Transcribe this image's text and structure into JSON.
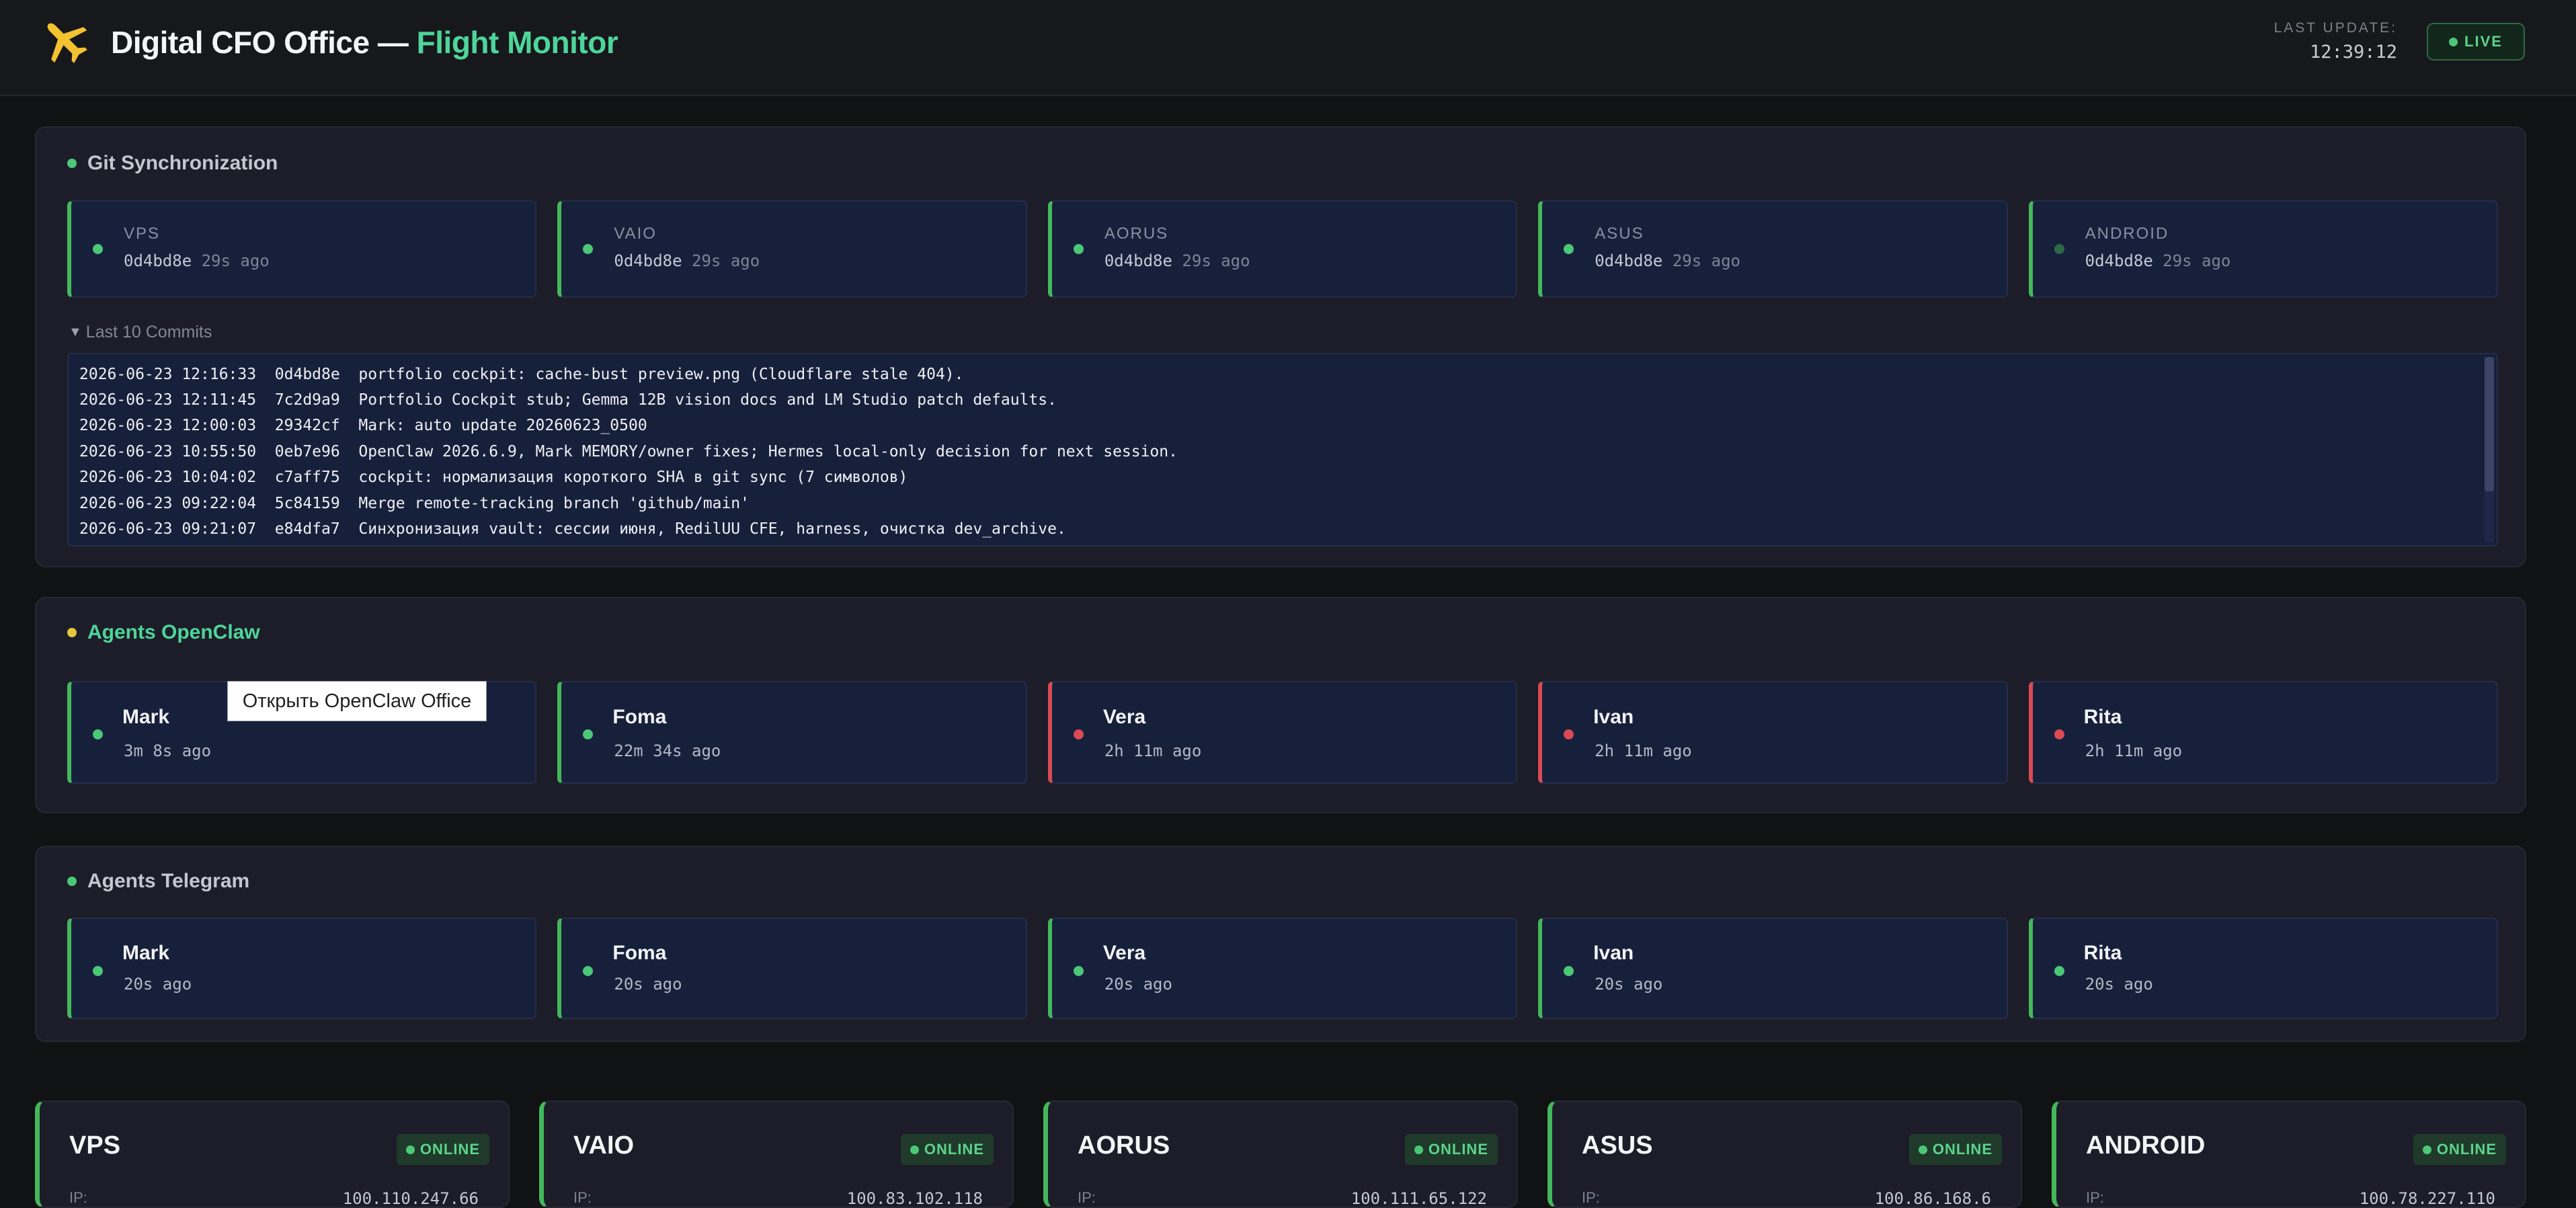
{
  "header": {
    "title_main": "Digital CFO Office — ",
    "title_accent": "Flight Monitor",
    "last_update_label": "LAST UPDATE:",
    "last_update_time": "12:39:12",
    "live_label": "LIVE",
    "accent_color": "#4ed59a"
  },
  "git": {
    "title": "Git Synchronization",
    "hosts": [
      {
        "name": "VPS",
        "hash": "0d4bd8e",
        "ago": "29s ago"
      },
      {
        "name": "VAIO",
        "hash": "0d4bd8e",
        "ago": "29s ago"
      },
      {
        "name": "AORUS",
        "hash": "0d4bd8e",
        "ago": "29s ago"
      },
      {
        "name": "ASUS",
        "hash": "0d4bd8e",
        "ago": "29s ago"
      },
      {
        "name": "ANDROID",
        "hash": "0d4bd8e",
        "ago": "29s ago"
      }
    ],
    "commits_toggle": "Last 10 Commits",
    "commits": [
      "2026-06-23 12:16:33  0d4bd8e  portfolio cockpit: cache-bust preview.png (Cloudflare stale 404).",
      "2026-06-23 12:11:45  7c2d9a9  Portfolio Cockpit stub; Gemma 12B vision docs and LM Studio patch defaults.",
      "2026-06-23 12:00:03  29342cf  Mark: auto update 20260623_0500",
      "2026-06-23 10:55:50  0eb7e96  OpenClaw 2026.6.9, Mark MEMORY/owner fixes; Hermes local-only decision for next session.",
      "2026-06-23 10:04:02  c7aff75  cockpit: нормализация короткого SHA в git sync (7 символов)",
      "2026-06-23 09:22:04  5c84159  Merge remote-tracking branch 'github/main'",
      "2026-06-23 09:21:07  e84dfa7  Синхронизация vault: сессии июня, RedilUU CFE, harness, очистка dev_archive."
    ]
  },
  "openclaw": {
    "title": "Agents OpenClaw",
    "title_color": "#4ed59a",
    "tooltip": "Открыть OpenClaw Office",
    "agents": [
      {
        "name": "Mark",
        "ago": "3m 8s ago",
        "status": "ok"
      },
      {
        "name": "Foma",
        "ago": "22m 34s ago",
        "status": "ok"
      },
      {
        "name": "Vera",
        "ago": "2h 11m ago",
        "status": "stale"
      },
      {
        "name": "Ivan",
        "ago": "2h 11m ago",
        "status": "stale"
      },
      {
        "name": "Rita",
        "ago": "2h 11m ago",
        "status": "stale"
      }
    ]
  },
  "telegram": {
    "title": "Agents Telegram",
    "agents": [
      {
        "name": "Mark",
        "ago": "20s ago"
      },
      {
        "name": "Foma",
        "ago": "20s ago"
      },
      {
        "name": "Vera",
        "ago": "20s ago"
      },
      {
        "name": "Ivan",
        "ago": "20s ago"
      },
      {
        "name": "Rita",
        "ago": "20s ago"
      }
    ]
  },
  "hosts": [
    {
      "name": "VPS",
      "status": "ONLINE",
      "ip_label": "IP:",
      "ip": "100.110.247.66"
    },
    {
      "name": "VAIO",
      "status": "ONLINE",
      "ip_label": "IP:",
      "ip": "100.83.102.118"
    },
    {
      "name": "AORUS",
      "status": "ONLINE",
      "ip_label": "IP:",
      "ip": "100.111.65.122"
    },
    {
      "name": "ASUS",
      "status": "ONLINE",
      "ip_label": "IP:",
      "ip": "100.86.168.6"
    },
    {
      "name": "ANDROID",
      "status": "ONLINE",
      "ip_label": "IP:",
      "ip": "100.78.227.110"
    }
  ],
  "icons": {
    "logo": "airplane-icon",
    "status": "status-dot-icon",
    "toggle": "triangle-down-icon"
  }
}
